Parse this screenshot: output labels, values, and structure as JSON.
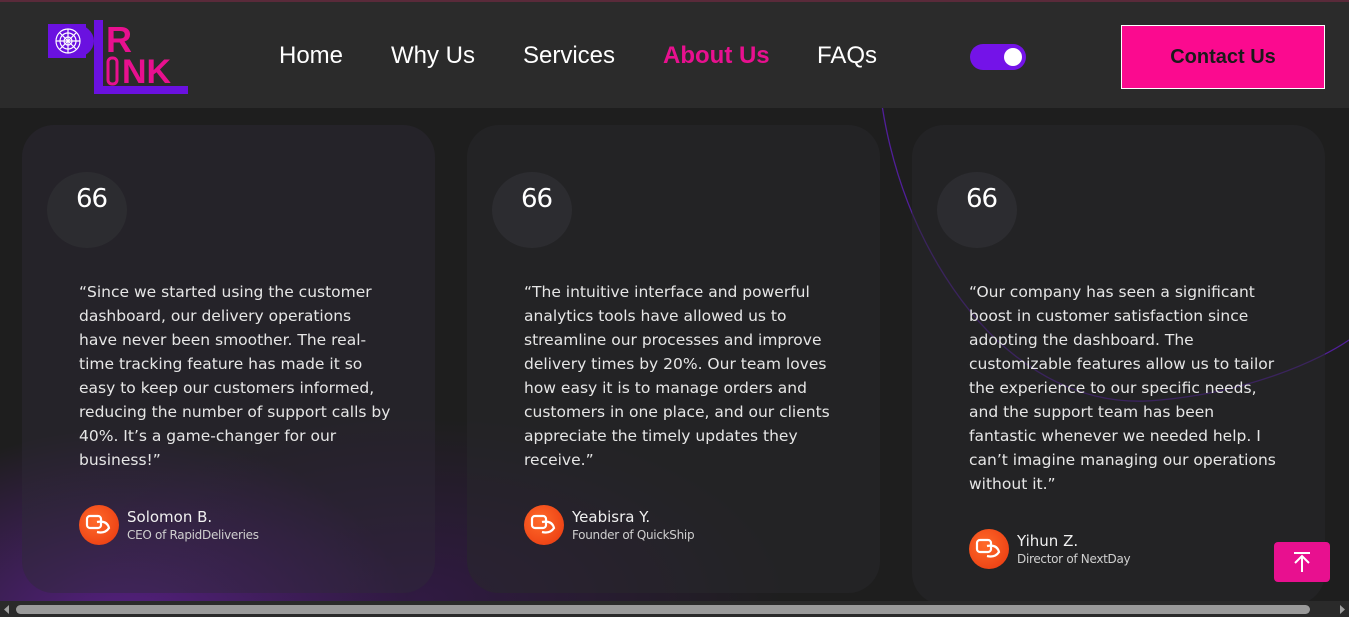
{
  "brand": {
    "logo_text": "DR LINK",
    "accent": "#e8108f",
    "purple": "#6a11e0"
  },
  "nav": {
    "items": [
      {
        "label": "Home",
        "active": false
      },
      {
        "label": "Why Us",
        "active": false
      },
      {
        "label": "Services",
        "active": false
      },
      {
        "label": "About Us",
        "active": true
      },
      {
        "label": "FAQs",
        "active": false
      }
    ],
    "theme_toggle": "on",
    "contact_label": "Contact Us"
  },
  "testimonials": [
    {
      "quote_mark": "66",
      "text": "“Since we started using the customer dashboard, our delivery operations have never been smoother. The real-time tracking feature has made it so easy to keep our customers informed, reducing the number of support calls by 40%. It’s a game-changer for our business!”",
      "name": "Solomon B.",
      "role": "CEO of RapidDeliveries"
    },
    {
      "quote_mark": "66",
      "text": "“The intuitive interface and powerful analytics tools have allowed us to streamline our processes and improve delivery times by 20%. Our team loves how easy it is to manage orders and customers in one place, and our clients appreciate the timely updates they receive.”",
      "name": "Yeabisra Y.",
      "role": "Founder of QuickShip"
    },
    {
      "quote_mark": "66",
      "text": "“Our company has seen a significant boost in customer satisfaction since adopting the dashboard. The customizable features allow us to tailor the experience to our specific needs, and the support team has been fantastic whenever we needed help. I can’t imagine managing our operations without it.”",
      "name": "Yihun Z.",
      "role": "Director of NextDay"
    }
  ],
  "icons": {
    "quote": "quote-icon",
    "avatar": "avatar-icon",
    "scroll_top": "arrow-up-icon"
  }
}
